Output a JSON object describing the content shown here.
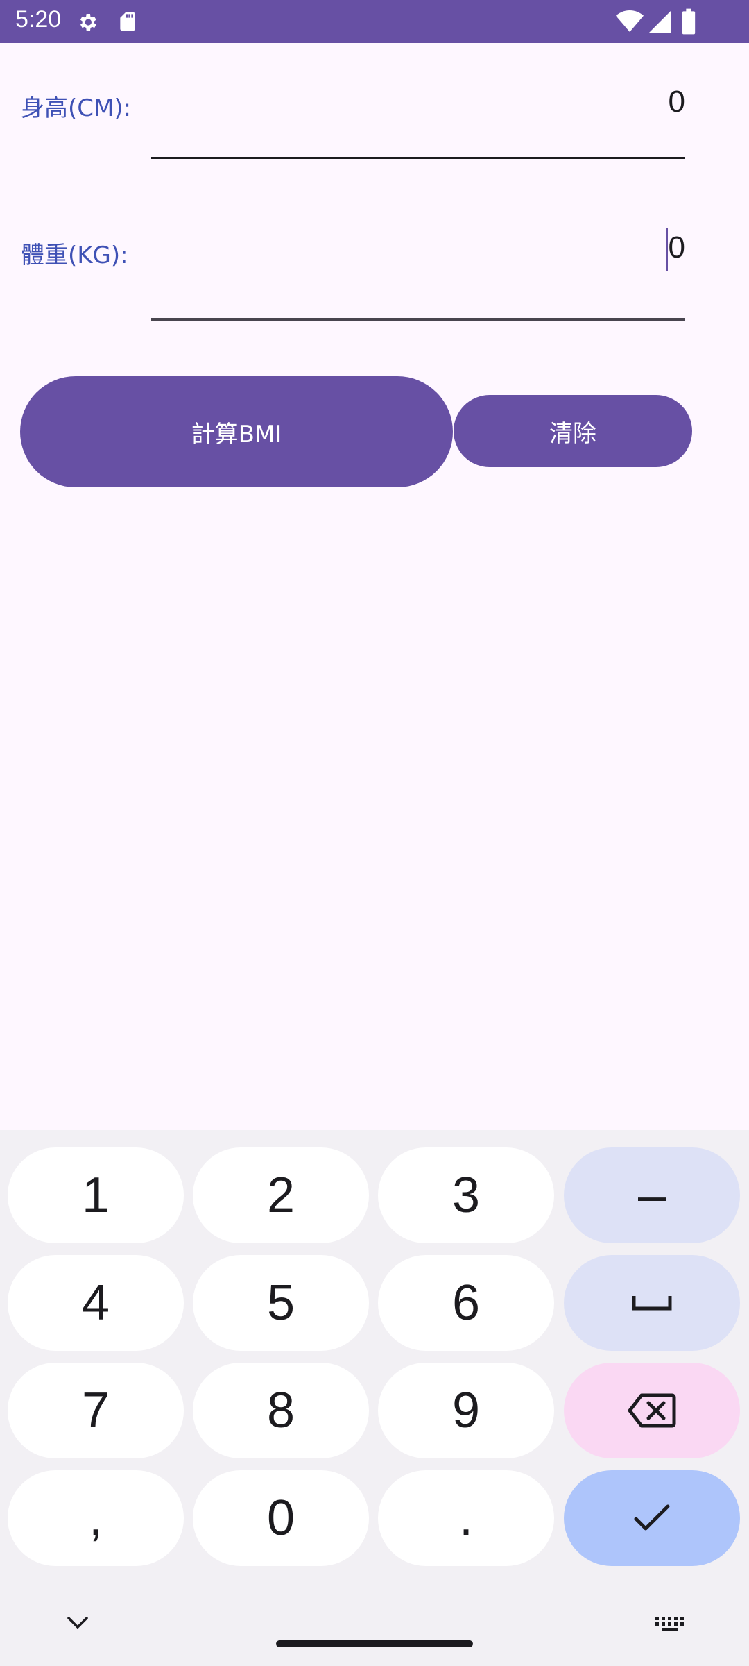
{
  "status_bar": {
    "time": "5:20",
    "icons_left": [
      "gear-icon",
      "sd-card-icon"
    ],
    "icons_right": [
      "wifi-icon",
      "signal-icon",
      "battery-icon"
    ],
    "background": "#6750A4"
  },
  "form": {
    "height_label": "身高(CM):",
    "height_value": "0",
    "weight_label": "體重(KG):",
    "weight_value": "0",
    "label_color": "#3F51B5"
  },
  "buttons": {
    "calculate_label": "計算BMI",
    "clear_label": "清除",
    "color": "#6750A4"
  },
  "keyboard": {
    "rows": [
      [
        "1",
        "2",
        "3",
        "–"
      ],
      [
        "4",
        "5",
        "6",
        "␣"
      ],
      [
        "7",
        "8",
        "9",
        "⌫"
      ],
      [
        ",",
        "0",
        ".",
        "✓"
      ]
    ],
    "nav_left_icon": "chevron-down-icon",
    "nav_right_icon": "keyboard-icon"
  }
}
